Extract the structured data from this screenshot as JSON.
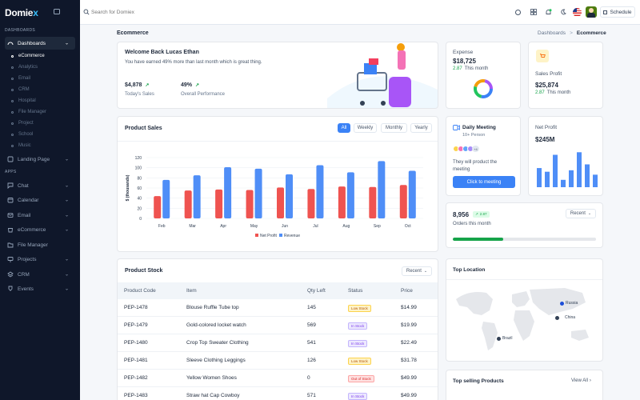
{
  "brand": {
    "name": "Domie",
    "accent": "x"
  },
  "sidebar": {
    "section_dashboards": "DASHBOARDS",
    "section_apps": "APPS",
    "dashboards_label": "Dashboards",
    "sub_items": [
      "eCommerce",
      "Analytics",
      "Email",
      "CRM",
      "Hospital",
      "File Manager",
      "Project",
      "School",
      "Music"
    ],
    "landing_page": "Landing Page",
    "apps": [
      "Chat",
      "Calendar",
      "Email",
      "eCommerce",
      "File Manager",
      "Projects",
      "CRM",
      "Events"
    ]
  },
  "topbar": {
    "search_placeholder": "Search for Domiex",
    "schedule_label": "Schedule"
  },
  "page": {
    "title": "Ecommerce",
    "breadcrumb_parent": "Dashboards",
    "breadcrumb_sep": ">",
    "breadcrumb_current": "Ecommerce"
  },
  "welcome": {
    "title": "Welcome Back Lucas Ethan",
    "subtitle": "You have earned 49% more than last month which is great thing.",
    "sales_value": "$4,878",
    "sales_label": "Today's Sales",
    "perf_value": "49%",
    "perf_label": "Overall Performance"
  },
  "expense": {
    "label": "Expense",
    "value": "$18,725",
    "change": "2.87",
    "period": "This month"
  },
  "sales_profit": {
    "label": "Sales Profit",
    "value": "$25,874",
    "change": "2.87",
    "period": "This month"
  },
  "product_sales": {
    "title": "Product Sales",
    "filters": [
      "All",
      "Weekly",
      "Monthly",
      "Yearly"
    ]
  },
  "chart_data": {
    "type": "bar",
    "title": "Product Sales",
    "ylabel": "$ (thousands)",
    "xlabel": "",
    "categories": [
      "Feb",
      "Mar",
      "Apr",
      "May",
      "Jun",
      "Jul",
      "Aug",
      "Sep",
      "Oct"
    ],
    "ylim": [
      0,
      120
    ],
    "yticks": [
      0,
      20,
      40,
      60,
      80,
      100,
      120
    ],
    "series": [
      {
        "name": "Net Profit",
        "color": "#ef5350",
        "values": [
          44,
          55,
          57,
          56,
          61,
          58,
          63,
          62,
          66
        ]
      },
      {
        "name": "Revenue",
        "color": "#4f8ef7",
        "values": [
          76,
          85,
          101,
          98,
          87,
          105,
          91,
          113,
          94
        ]
      }
    ],
    "legend_position": "bottom",
    "grid": true
  },
  "daily_meeting": {
    "title": "Daily Meeting",
    "subtitle": "10+ Person",
    "more": "+4",
    "text": "They will product the meeting",
    "button": "Click to meeting"
  },
  "net_profit": {
    "label": "Net Profit",
    "value": "$245M",
    "bar_color": "#4f8ef7",
    "bars": [
      0.52,
      0.42,
      0.88,
      0.2,
      0.46,
      0.95,
      0.62,
      0.34
    ]
  },
  "orders": {
    "value": "8,956",
    "change": "2.87",
    "label": "Orders this month",
    "dropdown": "Recent",
    "progress": 0.35
  },
  "stock": {
    "title": "Product Stock",
    "dropdown": "Recent",
    "headers": [
      "Product Code",
      "Item",
      "Qty Left",
      "Status",
      "Price"
    ],
    "rows": [
      {
        "code": "PEP-1478",
        "item": "Blouse Ruffle Tube top",
        "qty": "145",
        "status": "Low Stock",
        "status_type": "low",
        "price": "$14.99"
      },
      {
        "code": "PEP-1479",
        "item": "Gold-colored locket watch",
        "qty": "569",
        "status": "In Stock",
        "status_type": "in",
        "price": "$19.99"
      },
      {
        "code": "PEP-1480",
        "item": "Crop Top Sweater Clothing",
        "qty": "541",
        "status": "In Stock",
        "status_type": "in",
        "price": "$22.49"
      },
      {
        "code": "PEP-1481",
        "item": "Sleeve Clothing Leggings",
        "qty": "126",
        "status": "Low Stock",
        "status_type": "low",
        "price": "$31.78"
      },
      {
        "code": "PEP-1482",
        "item": "Yellow Women Shoes",
        "qty": "0",
        "status": "Out of Stock",
        "status_type": "out",
        "price": "$49.99"
      },
      {
        "code": "PEP-1483",
        "item": "Straw hat Cap Cowboy",
        "qty": "571",
        "status": "In Stock",
        "status_type": "in",
        "price": "$49.99"
      }
    ]
  },
  "top_location": {
    "title": "Top Location",
    "markers": [
      "Russia",
      "China",
      "Brazil"
    ]
  },
  "top_selling": {
    "title": "Top selling Products",
    "view_all": "View All"
  }
}
